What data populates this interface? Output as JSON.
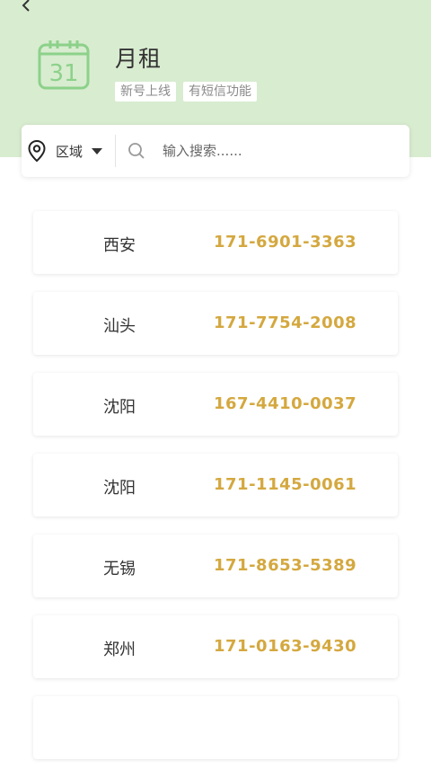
{
  "header": {
    "back_icon": "chevron-left-icon",
    "calendar_day": "31",
    "title": "月租",
    "tags": [
      "新号上线",
      "有短信功能"
    ]
  },
  "search": {
    "region_label": "区域",
    "placeholder": "输入搜索......"
  },
  "colors": {
    "header_bg": "#d8ecd0",
    "accent_green": "#8cd18a",
    "number_gold": "#d4a83f"
  },
  "items": [
    {
      "city": "西安",
      "number": "171-6901-3363"
    },
    {
      "city": "汕头",
      "number": "171-7754-2008"
    },
    {
      "city": "沈阳",
      "number": "167-4410-0037"
    },
    {
      "city": "沈阳",
      "number": "171-1145-0061"
    },
    {
      "city": "无锡",
      "number": "171-8653-5389"
    },
    {
      "city": "郑州",
      "number": "171-0163-9430"
    },
    {
      "city": "",
      "number": ""
    }
  ]
}
